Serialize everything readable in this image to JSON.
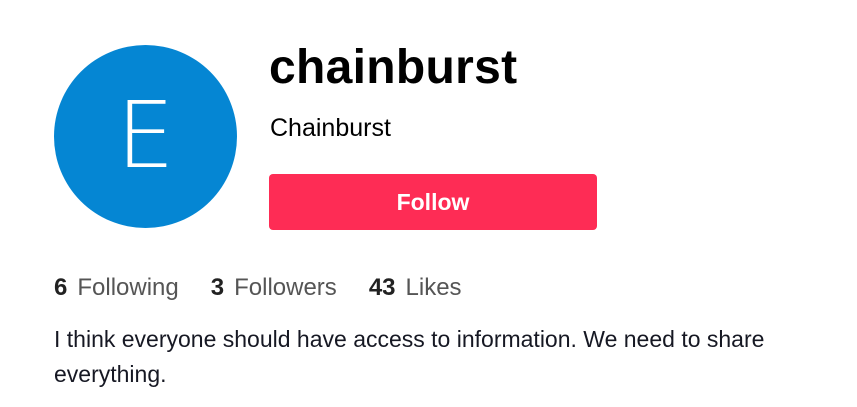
{
  "profile": {
    "avatar_letter": "E",
    "avatar_color": "#0586d3",
    "username": "chainburst",
    "display_name": "Chainburst",
    "follow_label": "Follow",
    "follow_color": "#fe2c55",
    "stats": {
      "following": {
        "count": "6",
        "label": "Following"
      },
      "followers": {
        "count": "3",
        "label": "Followers"
      },
      "likes": {
        "count": "43",
        "label": "Likes"
      }
    },
    "bio": "I think everyone should have access to information. We need to share everything."
  }
}
